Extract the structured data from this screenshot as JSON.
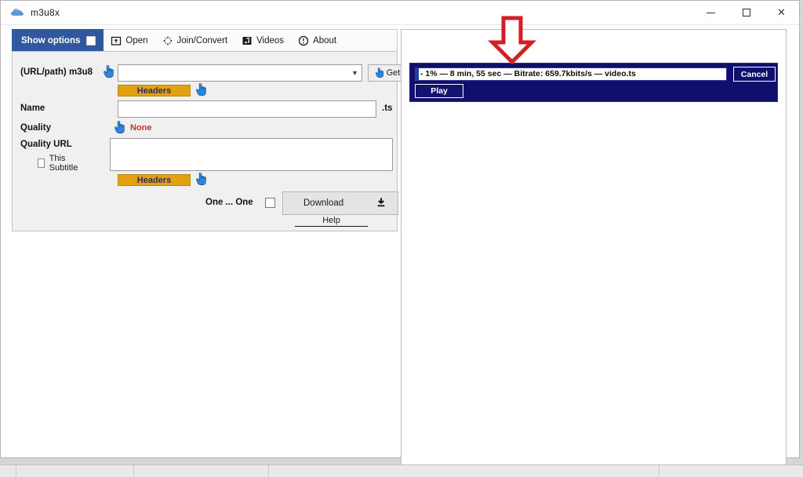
{
  "window": {
    "title": "m3u8x",
    "icon": "cloud-icon",
    "buttons": {
      "minimize": "minimize-icon",
      "maximize": "maximize-icon",
      "close": "✕"
    }
  },
  "tabs": {
    "show_options": {
      "label": "Show options",
      "checked": false
    },
    "items": [
      {
        "label": "Open",
        "icon": "open-folder-icon"
      },
      {
        "label": "Join/Convert",
        "icon": "four-arrows-icon"
      },
      {
        "label": "Videos",
        "icon": "video-note-icon"
      },
      {
        "label": "About",
        "icon": "info-circle-icon"
      }
    ]
  },
  "form": {
    "url_label": "(URL/path) m3u8",
    "url_value": "",
    "url_placeholder": "",
    "get_label": "Get",
    "get_icon": "hand-pointer-icon",
    "headers_label": "Headers",
    "name_label": "Name",
    "name_value": "",
    "name_extension": ".ts",
    "quality_label": "Quality",
    "quality_value": "None",
    "quality_url_label": "Quality URL",
    "quality_url_value": "",
    "subtitle_label": "This Subtitle",
    "subtitle_checked": false,
    "one_one_label": "One ... One",
    "one_one_checked": false,
    "download_label": "Download",
    "download_icon": "download-arrow-icon",
    "help_label": "Help",
    "hand_icon": "hand-pointer-icon"
  },
  "download": {
    "progress_text": "- 1% — 8 min, 55 sec — Bitrate: 659.7kbits/s  — video.ts",
    "progress_percent": 1,
    "percent_display": "1%",
    "time_remaining": "8 min, 55 sec",
    "bitrate": "659.7kbits/s",
    "filename": "video.ts",
    "cancel_label": "Cancel",
    "play_label": "Play"
  },
  "annotation": {
    "arrow": "red-down-arrow",
    "color": "#d21f24"
  }
}
